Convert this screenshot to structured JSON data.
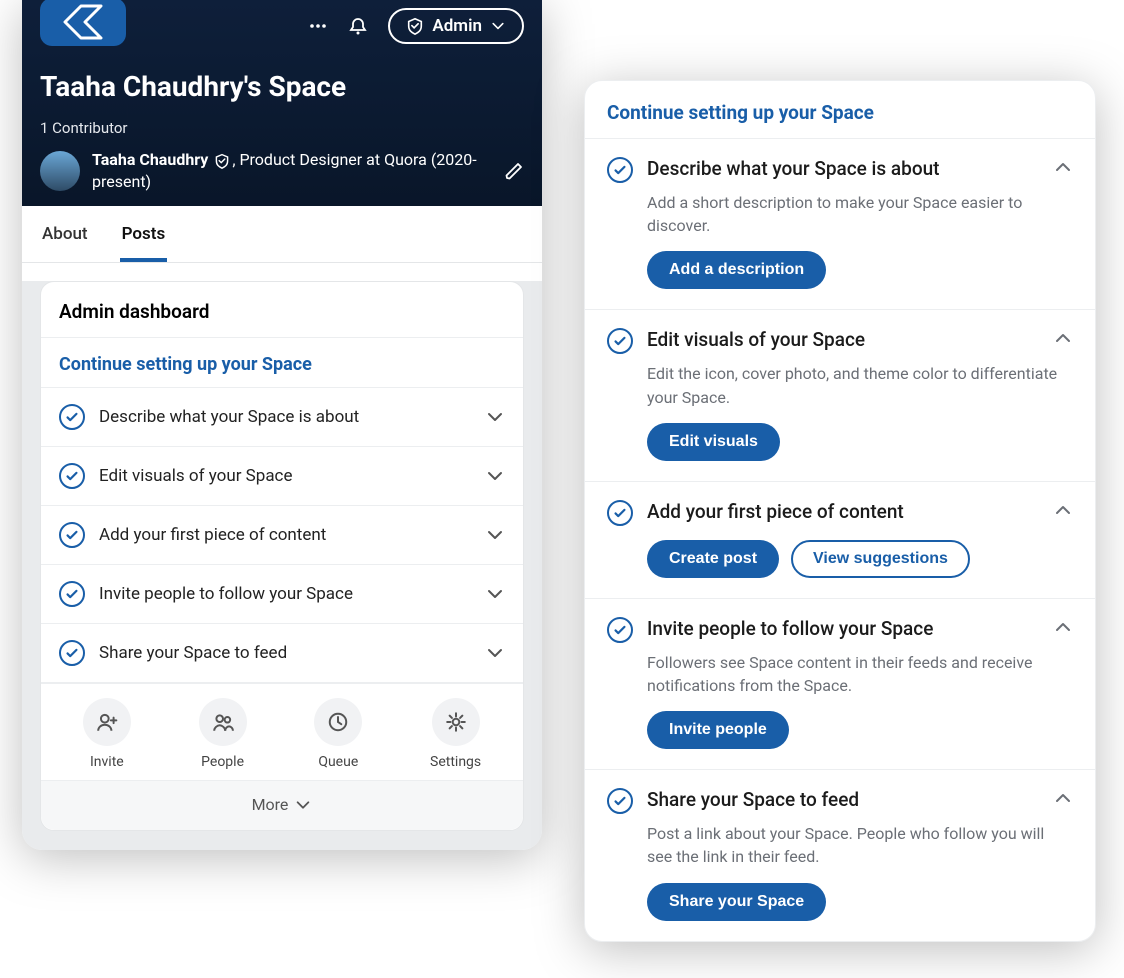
{
  "colors": {
    "accent": "#195ea8"
  },
  "header": {
    "admin_label": "Admin",
    "space_title": "Taaha Chaudhry's Space",
    "contributors_count_label": "1 Contributor",
    "contributor": {
      "name": "Taaha Chaudhry",
      "role_separator": ", ",
      "role": "Product Designer at Quora (2020-present)"
    }
  },
  "tabs": {
    "about": "About",
    "posts": "Posts"
  },
  "dashboard": {
    "title": "Admin dashboard",
    "setup_title": "Continue setting up your Space",
    "tasks": [
      {
        "label": "Describe what your Space is about"
      },
      {
        "label": "Edit visuals of your Space"
      },
      {
        "label": "Add your first piece of content"
      },
      {
        "label": "Invite people to follow your Space"
      },
      {
        "label": "Share your Space to feed"
      }
    ],
    "quick_actions": {
      "invite": "Invite",
      "people": "People",
      "queue": "Queue",
      "settings": "Settings"
    },
    "more": "More"
  },
  "setup_panel": {
    "title": "Continue setting up your Space",
    "tasks": [
      {
        "title": "Describe what your Space is about",
        "desc": "Add a short description to make your Space easier to discover.",
        "primary": "Add a description"
      },
      {
        "title": "Edit visuals of your Space",
        "desc": "Edit the icon, cover photo, and theme color to differentiate your Space.",
        "primary": "Edit visuals"
      },
      {
        "title": "Add your first piece of content",
        "primary": "Create post",
        "secondary": "View suggestions"
      },
      {
        "title": "Invite people to follow your Space",
        "desc": "Followers see Space content in their feeds and receive notifications from the Space.",
        "primary": "Invite people"
      },
      {
        "title": "Share your Space to feed",
        "desc": "Post a link about your Space. People who follow you will see the link in their feed.",
        "primary": "Share your Space"
      }
    ]
  }
}
